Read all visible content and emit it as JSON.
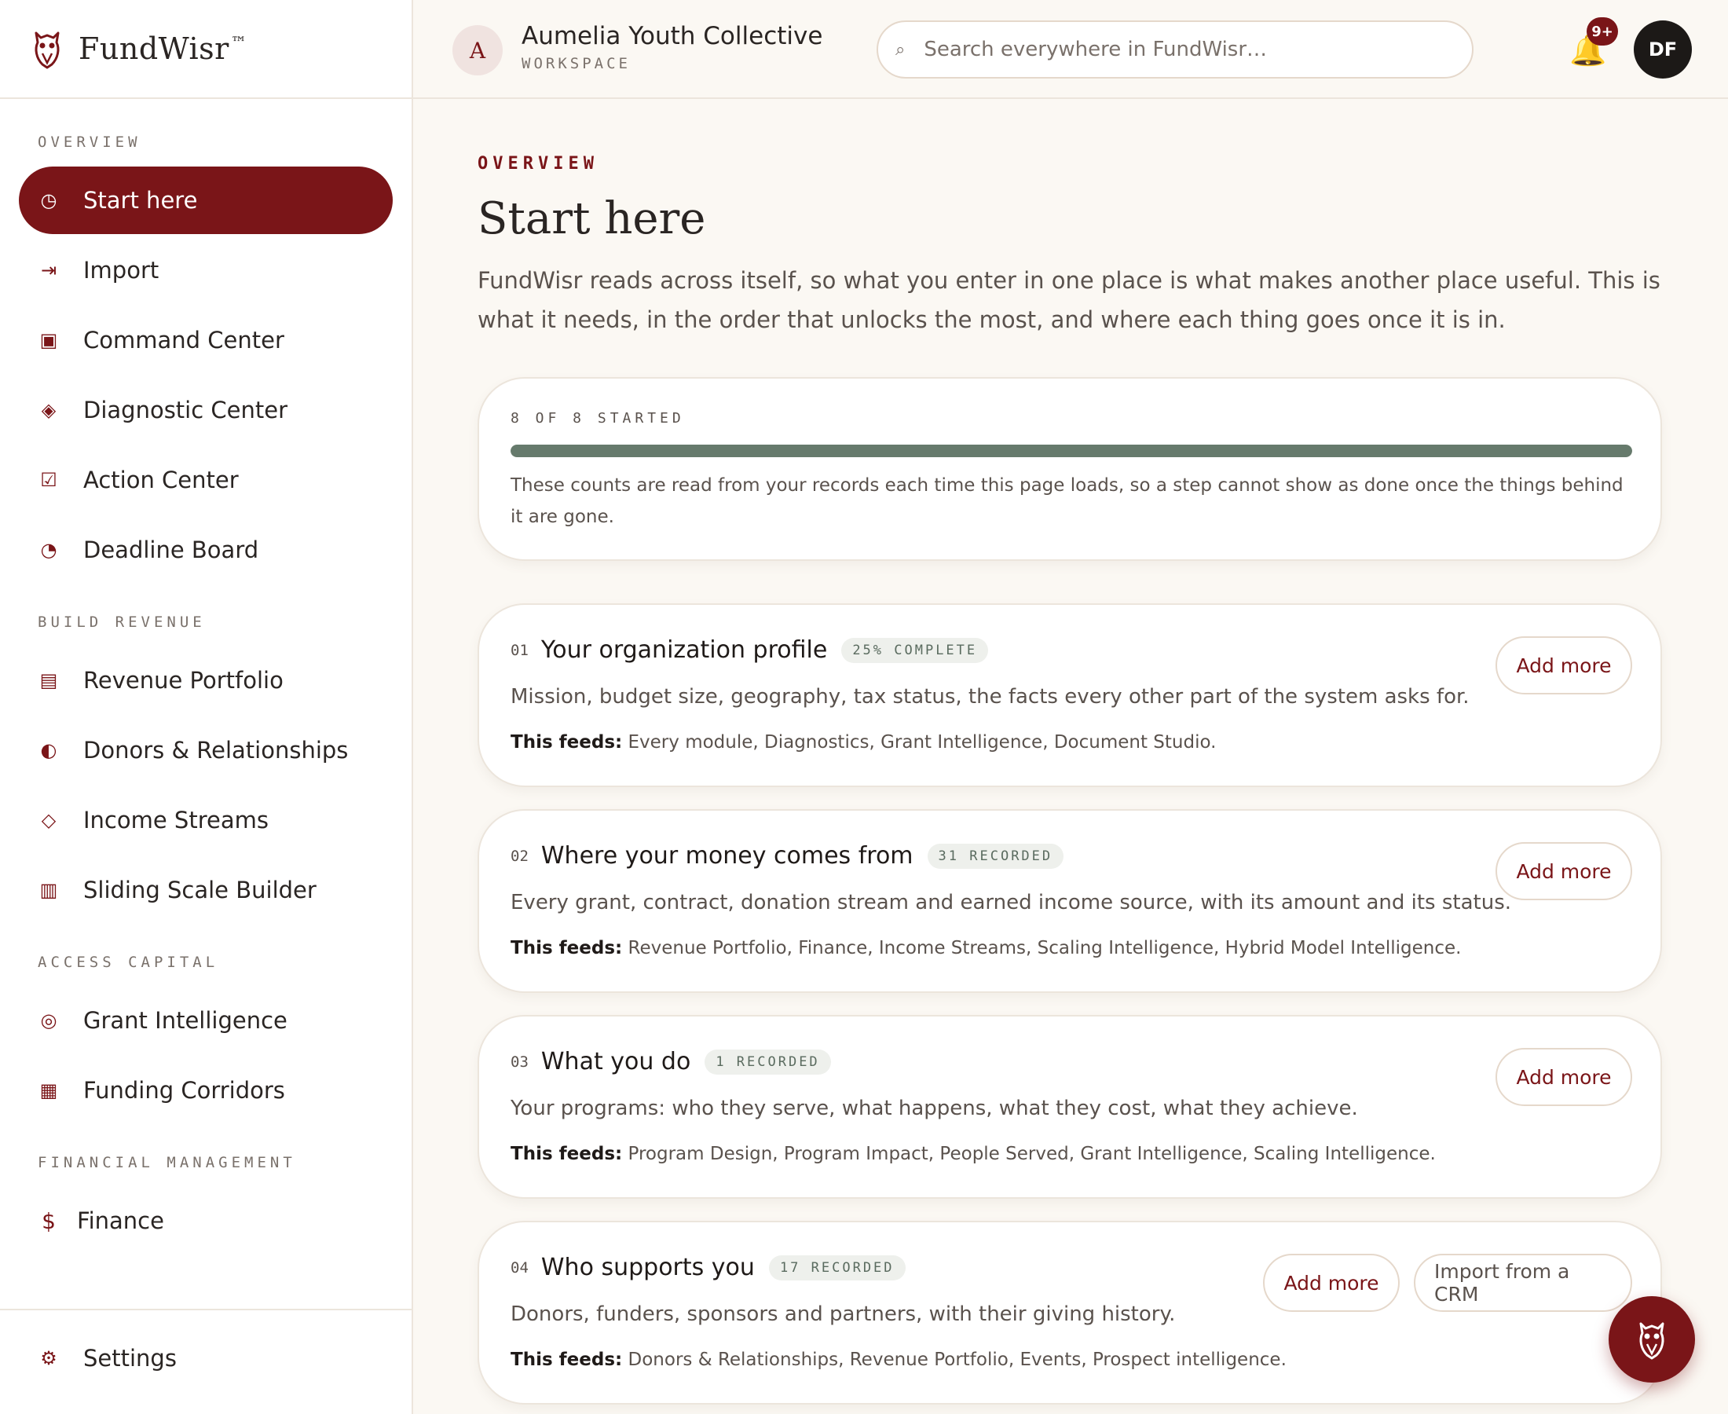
{
  "brand": {
    "name": "FundWisr",
    "tm": "™"
  },
  "workspace": {
    "initial": "A",
    "name": "Aumelia Youth Collective",
    "label": "WORKSPACE"
  },
  "search": {
    "placeholder": "Search everywhere in FundWisr…"
  },
  "notifications": {
    "count": "9+"
  },
  "user": {
    "initials": "DF"
  },
  "nav": {
    "sections": [
      {
        "title": "OVERVIEW",
        "items": [
          {
            "label": "Start here",
            "icon": "clock-icon",
            "active": true
          },
          {
            "label": "Import",
            "icon": "import-arrow-icon"
          },
          {
            "label": "Command Center",
            "icon": "square-icon"
          },
          {
            "label": "Diagnostic Center",
            "icon": "diamond-icon"
          },
          {
            "label": "Action Center",
            "icon": "checkbox-icon"
          },
          {
            "label": "Deadline Board",
            "icon": "pie-icon"
          }
        ]
      },
      {
        "title": "BUILD REVENUE",
        "items": [
          {
            "label": "Revenue Portfolio",
            "icon": "list-icon"
          },
          {
            "label": "Donors & Relationships",
            "icon": "half-circle-icon"
          },
          {
            "label": "Income Streams",
            "icon": "diamond-outline-icon"
          },
          {
            "label": "Sliding Scale Builder",
            "icon": "columns-icon"
          }
        ]
      },
      {
        "title": "ACCESS CAPITAL",
        "items": [
          {
            "label": "Grant Intelligence",
            "icon": "target-icon"
          },
          {
            "label": "Funding Corridors",
            "icon": "grid-icon"
          }
        ]
      },
      {
        "title": "FINANCIAL MANAGEMENT",
        "items": [
          {
            "label": "Finance",
            "icon": "dollar-icon"
          }
        ]
      }
    ],
    "footer": {
      "label": "Settings",
      "icon": "gear-icon"
    }
  },
  "page": {
    "eyebrow": "OVERVIEW",
    "title": "Start here",
    "intro": "FundWisr reads across itself, so what you enter in one place is what makes another place useful. This is what it needs, in the order that unlocks the most, and where each thing goes once it is in."
  },
  "progress": {
    "label": "8 OF 8 STARTED",
    "started": 8,
    "total": 8,
    "note": "These counts are read from your records each time this page loads, so a step cannot show as done once the things behind it are gone."
  },
  "feeds_label": "This feeds:",
  "steps": [
    {
      "num": "01",
      "title": "Your organization profile",
      "badge": "25% COMPLETE",
      "desc": "Mission, budget size, geography, tax status, the facts every other part of the system asks for.",
      "feeds": "Every module, Diagnostics, Grant Intelligence, Document Studio.",
      "actions": [
        "Add more"
      ]
    },
    {
      "num": "02",
      "title": "Where your money comes from",
      "badge": "31 RECORDED",
      "desc": "Every grant, contract, donation stream and earned income source, with its amount and its status.",
      "feeds": "Revenue Portfolio, Finance, Income Streams, Scaling Intelligence, Hybrid Model Intelligence.",
      "actions": [
        "Add more"
      ]
    },
    {
      "num": "03",
      "title": "What you do",
      "badge": "1 RECORDED",
      "desc": "Your programs: who they serve, what happens, what they cost, what they achieve.",
      "feeds": "Program Design, Program Impact, People Served, Grant Intelligence, Scaling Intelligence.",
      "actions": [
        "Add more"
      ]
    },
    {
      "num": "04",
      "title": "Who supports you",
      "badge": "17 RECORDED",
      "desc": "Donors, funders, sponsors and partners, with their giving history.",
      "feeds": "Donors & Relationships, Revenue Portfolio, Events, Prospect intelligence.",
      "actions": [
        "Add more",
        "Import from a CRM"
      ]
    }
  ],
  "colors": {
    "accent": "#7a1518",
    "progress": "#667a6c",
    "background": "#fbf8f3"
  }
}
